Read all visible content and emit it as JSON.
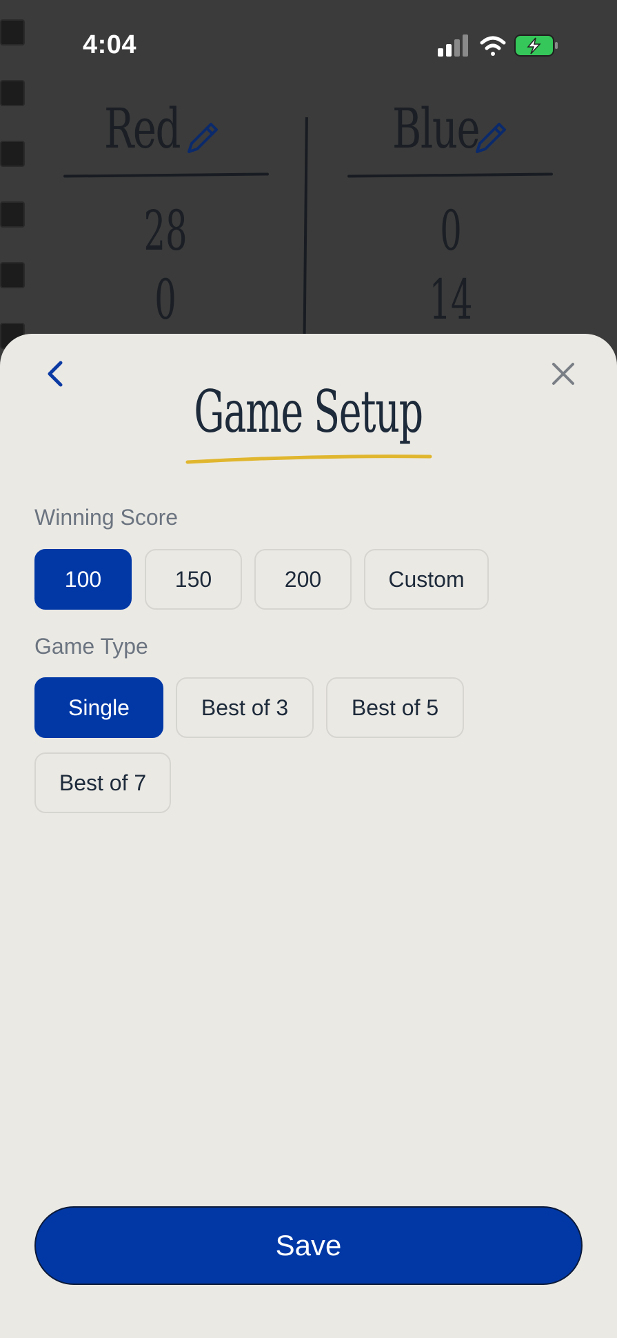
{
  "status_bar": {
    "time": "4:04"
  },
  "scoreboard": {
    "teams": [
      {
        "name": "Red",
        "scores": [
          "28",
          "0"
        ]
      },
      {
        "name": "Blue",
        "scores": [
          "0",
          "14"
        ]
      }
    ]
  },
  "sheet": {
    "title": "Game Setup",
    "winning_score": {
      "label": "Winning Score",
      "options": [
        "100",
        "150",
        "200",
        "Custom"
      ],
      "selected": "100"
    },
    "game_type": {
      "label": "Game Type",
      "options": [
        "Single",
        "Best of 3",
        "Best of 5",
        "Best of 7"
      ],
      "selected": "Single"
    },
    "save_label": "Save"
  },
  "colors": {
    "accent": "#0138a6",
    "sheet_bg": "#ebe9e4",
    "title_underline": "#e0b62e",
    "battery": "#35c759"
  },
  "icons": [
    "back-chevron-icon",
    "close-icon",
    "pencil-icon",
    "signal-icon",
    "wifi-icon",
    "battery-charging-icon"
  ]
}
